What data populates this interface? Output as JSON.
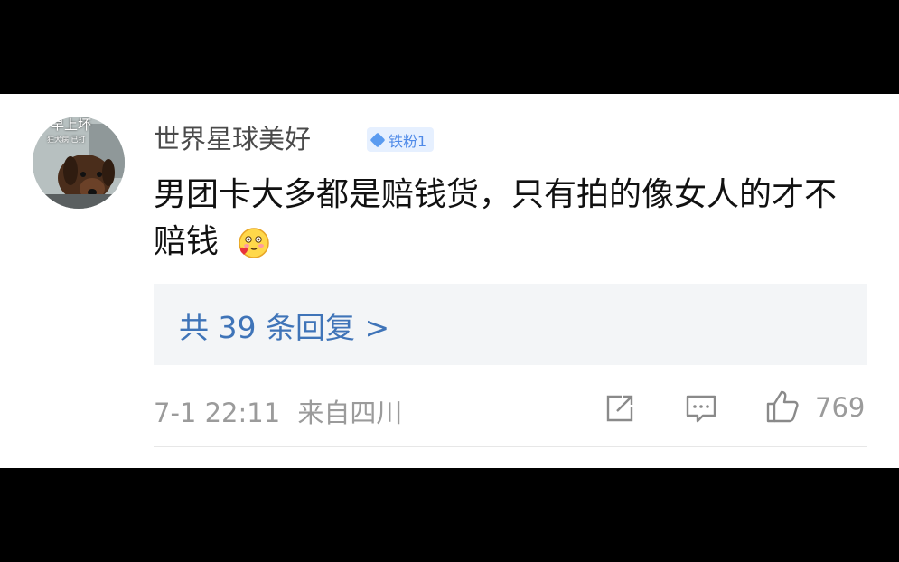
{
  "comment": {
    "username": "世界星球美好",
    "badge_label": "铁粉1",
    "text": "男团卡大多都是赔钱货，只有拍的像女人的才不赔钱",
    "emoji_icon": "blush-heart-emoji",
    "replies_label": "共 39 条回复 >",
    "timestamp": "7-1 22:11",
    "location": "来自四川",
    "likes_count": "769"
  },
  "avatar": {
    "overlay_text": "早上坏",
    "overlay_sub": "狂犬病 已打"
  },
  "colors": {
    "link_blue": "#3f74b8",
    "badge_bg": "#e6f0ff",
    "meta_gray": "#9b9b9b"
  }
}
